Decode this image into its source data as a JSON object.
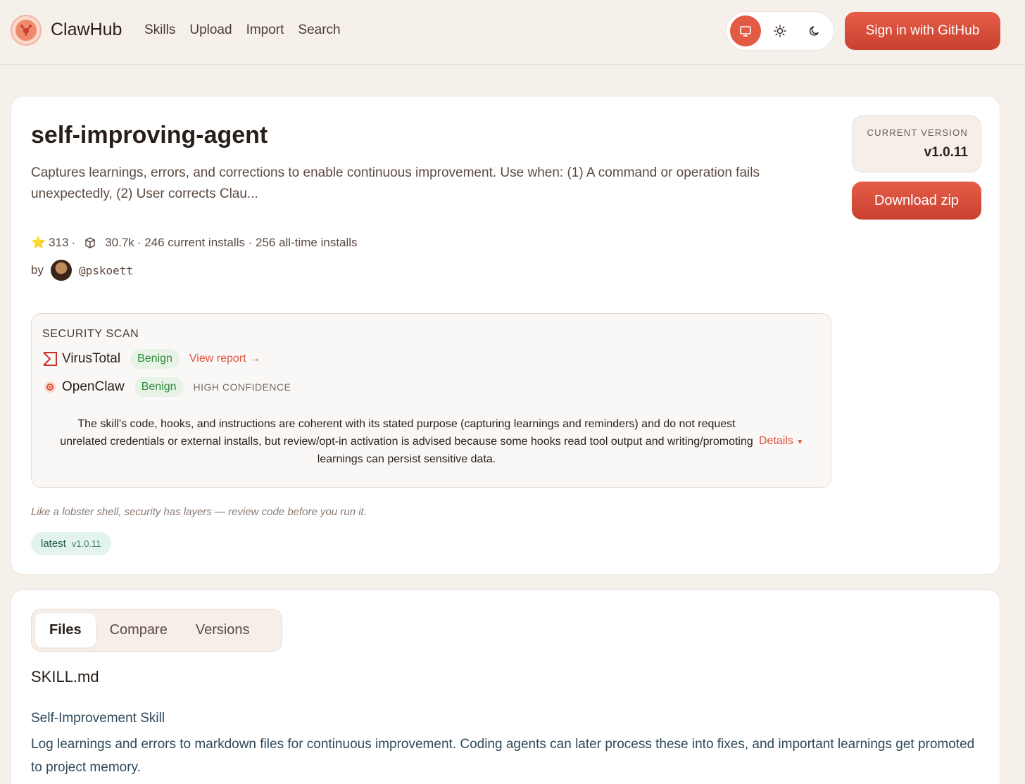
{
  "header": {
    "brand": "ClawHub",
    "nav": [
      "Skills",
      "Upload",
      "Import",
      "Search"
    ],
    "theme_buttons": [
      {
        "icon": "monitor-icon",
        "active": true
      },
      {
        "icon": "sun-icon",
        "active": false
      },
      {
        "icon": "moon-icon",
        "active": false
      }
    ],
    "signin_label": "Sign in  with GitHub"
  },
  "skill": {
    "title": "self-improving-agent",
    "description": "Captures learnings, errors, and corrections to enable continuous improvement. Use when: (1) A command or operation fails unexpectedly, (2) User corrects Clau...",
    "stars": "313",
    "stars_sep": "·",
    "downloads": "30.7k",
    "installs_text": "· 246 current installs · 256 all-time installs",
    "by_label": "by",
    "author_handle": "@pskoett",
    "current_version_label": "CURRENT VERSION",
    "current_version": "v1.0.11",
    "download_label": "Download zip"
  },
  "security_scan": {
    "title": "SECURITY SCAN",
    "virustotal": {
      "name": "VirusTotal",
      "verdict": "Benign",
      "link": "View report →"
    },
    "openclaw": {
      "name": "OpenClaw",
      "verdict": "Benign",
      "confidence": "HIGH CONFIDENCE"
    },
    "summary": "The skill's code, hooks, and instructions are coherent with its stated purpose (capturing learnings and reminders) and do not request unrelated credentials or external installs, but review/opt-in activation is advised because some hooks read tool output and writing/promoting learnings can persist sensitive data.",
    "details_label": "Details"
  },
  "note": "Like a lobster shell, security has layers — review code before you run it.",
  "tag": {
    "name": "latest",
    "version": "v1.0.11"
  },
  "files_panel": {
    "tabs": [
      "Files",
      "Compare",
      "Versions"
    ],
    "active_tab": "Files",
    "filename": "SKILL.md",
    "heading": "Self-Improvement Skill",
    "paragraph": "Log learnings and errors to markdown files for continuous improvement. Coding agents can later process these into fixes, and important learnings get promoted to project memory."
  },
  "colors": {
    "accent": "#e35a45",
    "background": "#f6f0eb",
    "benign": "#2f8a3a"
  }
}
